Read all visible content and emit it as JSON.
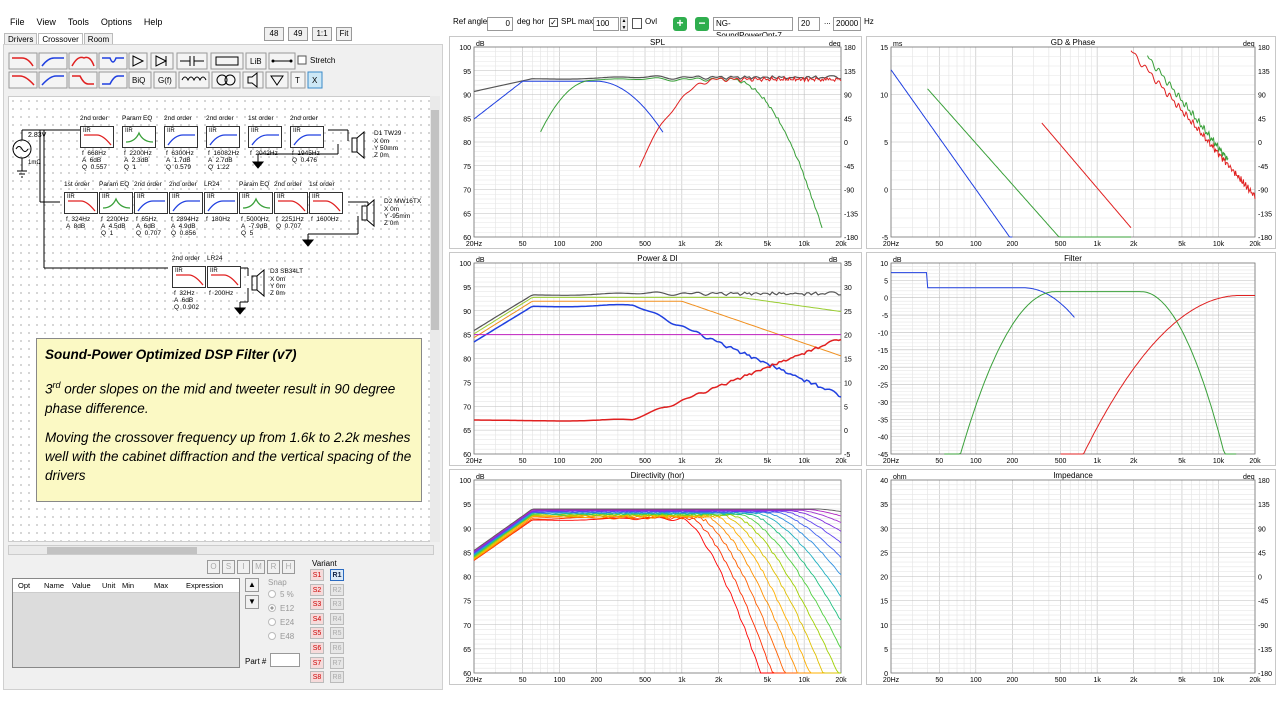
{
  "menu": [
    "File",
    "View",
    "Tools",
    "Options",
    "Help"
  ],
  "tabs": [
    "Drivers",
    "Crossover",
    "Room"
  ],
  "topButtons": [
    "48",
    "49",
    "1:1",
    "Fit"
  ],
  "toolbar": {
    "lib": "LiB",
    "biq": "BiQ",
    "gf": "G(f)",
    "stretch": "Stretch",
    "t": "T",
    "x": "X"
  },
  "topbar": {
    "refAngleLabel": "Ref angle",
    "refAngle": "0",
    "degHor": "deg hor",
    "splMaxLabel": "SPL max",
    "splMax": "100",
    "ovl": "Ovl",
    "name": "NG-SoundPowerOpt-7",
    "fmin": "20",
    "dots": "...",
    "fmax": "20000",
    "hz": "Hz"
  },
  "schematic": {
    "voltage": "2.83V",
    "rsrc": "1mΩ",
    "row1": [
      {
        "label": "2nd order",
        "params": "f  668Hz\nA  6dB\nQ  0.557"
      },
      {
        "label": "Param EQ",
        "params": "f  2200Hz\nA  2.3dB\nQ  1"
      },
      {
        "label": "2nd order",
        "params": "f  6300Hz\nA  1.7dB\nQ  0.579"
      },
      {
        "label": "2nd order",
        "params": "f  16082Hz\nA  2.7dB\nQ  1.22"
      },
      {
        "label": "1st order",
        "params": "f  2042Hz"
      },
      {
        "label": "2nd order",
        "params": "f  1945Hz\nQ  0.476"
      }
    ],
    "row2": [
      {
        "label": "1st order",
        "params": "f  324Hz\nA  8dB"
      },
      {
        "label": "Param EQ",
        "params": "f  2200Hz\nA  4.5dB\nQ  1"
      },
      {
        "label": "2nd order",
        "params": "f  65Hz\nA  6dB\nQ  0.707"
      },
      {
        "label": "2nd order",
        "params": "f  2894Hz\nA  4.9dB\nQ  0.856"
      },
      {
        "label": "LR24",
        "params": "f  180Hz"
      },
      {
        "label": "Param EQ",
        "params": "f  5000Hz\nA  -7.9dB\nQ  5"
      },
      {
        "label": "2nd order",
        "params": "f  2251Hz\nQ  0.707"
      },
      {
        "label": "1st order",
        "params": "f  1600Hz"
      }
    ],
    "row3": [
      {
        "label": "2nd order",
        "params": "f  32Hz\nA  6dB\nQ  0.902"
      },
      {
        "label": "LR24",
        "params": "f  200Hz"
      }
    ],
    "drivers": [
      {
        "name": "D1 TW29",
        "params": "X 0m\nY 50mm\nZ 0m"
      },
      {
        "name": "D2 MW16TX",
        "params": "X 0m\nY -95mm\nZ 0m"
      },
      {
        "name": "D3 SB34LT",
        "params": "X 0m\nY 0m\nZ 0m"
      }
    ]
  },
  "note": {
    "title": "Sound-Power Optimized DSP Filter (v7)",
    "p1a": "3",
    "p1sup": "rd",
    "p1b": " order slopes on the mid and tweeter result in 90 degree phase difference.",
    "p2": "Moving the crossover frequency up from 1.6k to 2.2k meshes well with the cabinet diffraction and the vertical spacing of the drivers"
  },
  "optButtons": [
    "O",
    "S",
    "I",
    "M",
    "R",
    "H"
  ],
  "optColumns": [
    "Opt",
    "Name",
    "Value",
    "Unit",
    "Min",
    "Max",
    "Expression"
  ],
  "snap": {
    "label": "Snap",
    "options": [
      "5 %",
      "E12",
      "E24",
      "E48"
    ],
    "part": "Part #"
  },
  "variant": {
    "label": "Variant",
    "s": [
      "S1",
      "S2",
      "S3",
      "S4",
      "S5",
      "S6",
      "S7",
      "S8"
    ],
    "r": [
      "R1",
      "R2",
      "R3",
      "R4",
      "R5",
      "R6",
      "R7",
      "R8"
    ]
  },
  "plots": {
    "spl": {
      "title": "SPL",
      "lunit": "dB",
      "runit": "deg"
    },
    "gd": {
      "title": "GD & Phase",
      "lunit": "ms",
      "runit": "deg"
    },
    "power": {
      "title": "Power & DI",
      "lunit": "dB",
      "runit": "dB"
    },
    "filter": {
      "title": "Filter",
      "lunit": "dB",
      "runit": ""
    },
    "directivity": {
      "title": "Directivity (hor)",
      "lunit": "dB",
      "runit": ""
    },
    "impedance": {
      "title": "Impedance",
      "lunit": "ohm",
      "runit": "deg"
    }
  },
  "axes": {
    "x": [
      "20Hz",
      "50",
      "100",
      "200",
      "500",
      "1k",
      "2k",
      "5k",
      "10k",
      "20k"
    ],
    "db100": [
      "100",
      "95",
      "90",
      "85",
      "80",
      "75",
      "70",
      "65",
      "60"
    ],
    "deg180": [
      "180",
      "135",
      "90",
      "45",
      "0",
      "-45",
      "-90",
      "-135",
      "-180"
    ],
    "di": [
      "35",
      "30",
      "25",
      "20",
      "15",
      "10",
      "5",
      "0",
      "-5"
    ],
    "ms": [
      "15",
      "10",
      "5",
      "0",
      "-5"
    ],
    "filt": [
      "10",
      "5",
      "0",
      "-5",
      "-10",
      "-15",
      "-20",
      "-25",
      "-30",
      "-35",
      "-40",
      "-45"
    ],
    "ohm": [
      "40",
      "35",
      "30",
      "25",
      "20",
      "15",
      "10",
      "5",
      "0"
    ]
  },
  "colors": {
    "red": "#e02020",
    "green": "#3aa03a",
    "blue": "#2040e0",
    "gray": "#555555",
    "orange": "#f09020",
    "lime": "#9acd32",
    "magenta": "#c020c0"
  }
}
